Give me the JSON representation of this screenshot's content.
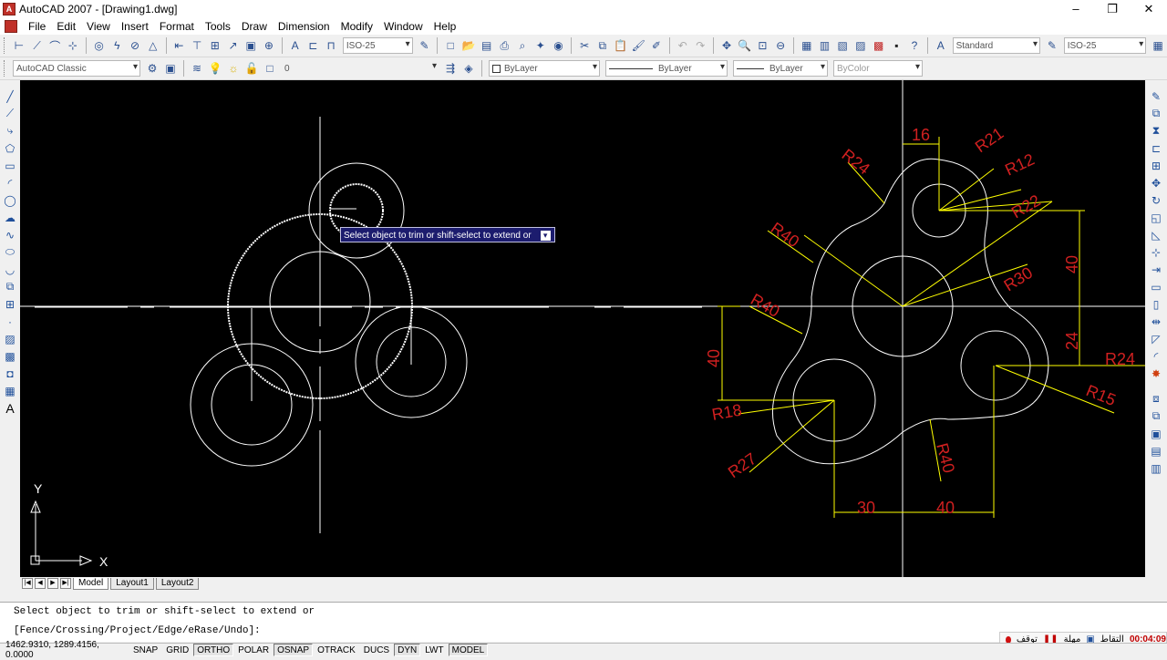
{
  "window": {
    "title": "AutoCAD 2007 - [Drawing1.dwg]",
    "controls": [
      "–",
      "❐",
      "✕"
    ]
  },
  "menu": [
    "File",
    "Edit",
    "View",
    "Insert",
    "Format",
    "Tools",
    "Draw",
    "Dimension",
    "Modify",
    "Window",
    "Help"
  ],
  "toolbar1": {
    "dimstyle": "ISO-25",
    "textstyle": "Standard",
    "dimstyle2": "ISO-25"
  },
  "toolbar2": {
    "workspace": "AutoCAD Classic",
    "layer": "0",
    "color": "ByLayer",
    "linetype": "ByLayer",
    "lineweight": "ByLayer",
    "plotstyle": "ByColor"
  },
  "canvas": {
    "tooltip": "Select object to trim or shift-select to extend or",
    "ucs": {
      "x": "X",
      "y": "Y"
    },
    "dimensions": {
      "horizontal": [
        "16",
        "30",
        "40"
      ],
      "vertical": [
        "40",
        "24",
        "40"
      ],
      "radii": [
        "R24",
        "R21",
        "R12",
        "R22",
        "R40",
        "R30",
        "R40",
        "R24",
        "R15",
        "R18",
        "R27",
        "R40"
      ]
    }
  },
  "layout_tabs": [
    "Model",
    "Layout1",
    "Layout2"
  ],
  "command": {
    "line1": "Select object to trim or shift-select to extend or",
    "line2": "[Fence/Crossing/Project/Edge/eRase/Undo]:"
  },
  "status": {
    "coords": "1462.9310, 1289.4156, 0.0000",
    "toggles": [
      {
        "label": "SNAP",
        "on": false
      },
      {
        "label": "GRID",
        "on": false
      },
      {
        "label": "ORTHO",
        "on": true
      },
      {
        "label": "POLAR",
        "on": false
      },
      {
        "label": "OSNAP",
        "on": true
      },
      {
        "label": "OTRACK",
        "on": false
      },
      {
        "label": "DUCS",
        "on": false
      },
      {
        "label": "DYN",
        "on": true
      },
      {
        "label": "LWT",
        "on": false
      },
      {
        "label": "MODEL",
        "on": true
      }
    ]
  },
  "recorder": {
    "stop": "توقف",
    "pause": "مهلة",
    "capture": "التقاط",
    "time": "00:04:09"
  }
}
